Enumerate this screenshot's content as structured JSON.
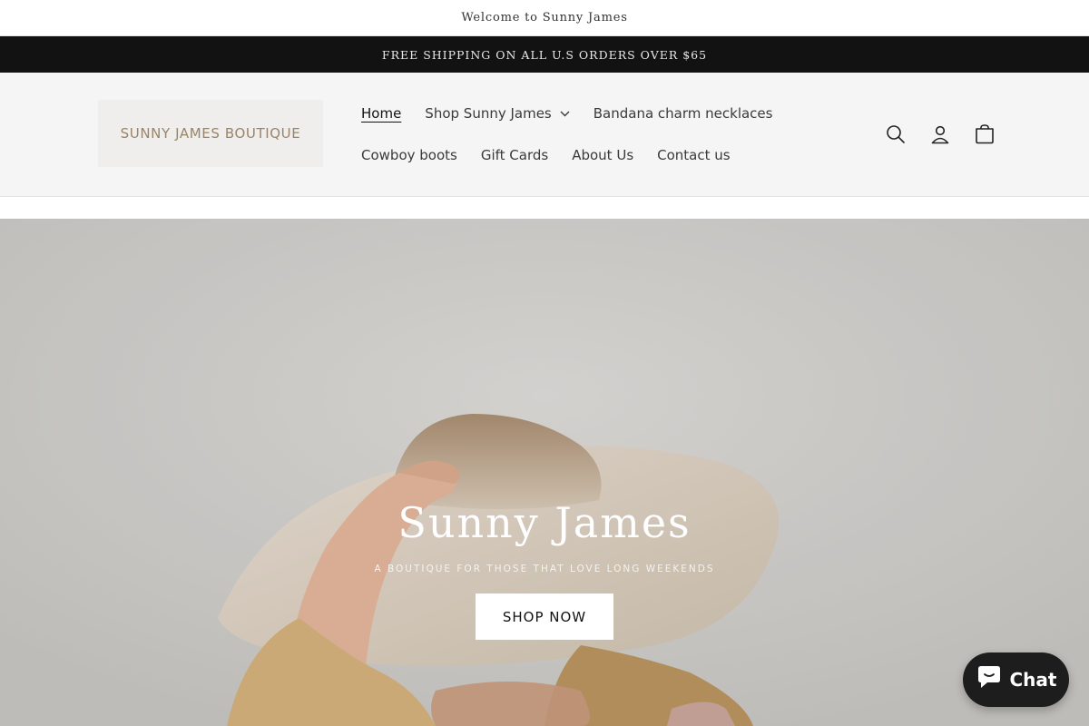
{
  "announcement": {
    "welcome": "Welcome to Sunny James",
    "shipping": "FREE SHIPPING ON ALL U.S ORDERS OVER $65"
  },
  "header": {
    "logo_text": "SUNNY JAMES BOUTIQUE",
    "nav": [
      {
        "label": "Home",
        "active": true
      },
      {
        "label": "Shop Sunny James",
        "has_dropdown": true
      },
      {
        "label": "Bandana charm necklaces"
      },
      {
        "label": "Cowboy boots"
      },
      {
        "label": "Gift Cards"
      },
      {
        "label": "About Us"
      },
      {
        "label": "Contact us"
      }
    ],
    "icons": [
      "search-icon",
      "account-icon",
      "cart-icon"
    ]
  },
  "hero": {
    "title": "Sunny James",
    "subtitle": "A BOUTIQUE FOR THOSE THAT LOVE LONG WEEKENDS",
    "button_label": "SHOP NOW"
  },
  "chat": {
    "label": "Chat",
    "icon": "chat-bubble-icon"
  },
  "colors": {
    "shipping_bar_bg": "#121212",
    "header_bg": "#f5f5f5",
    "logo_text": "#9a8467",
    "chat_bg": "#1d1d1d"
  }
}
